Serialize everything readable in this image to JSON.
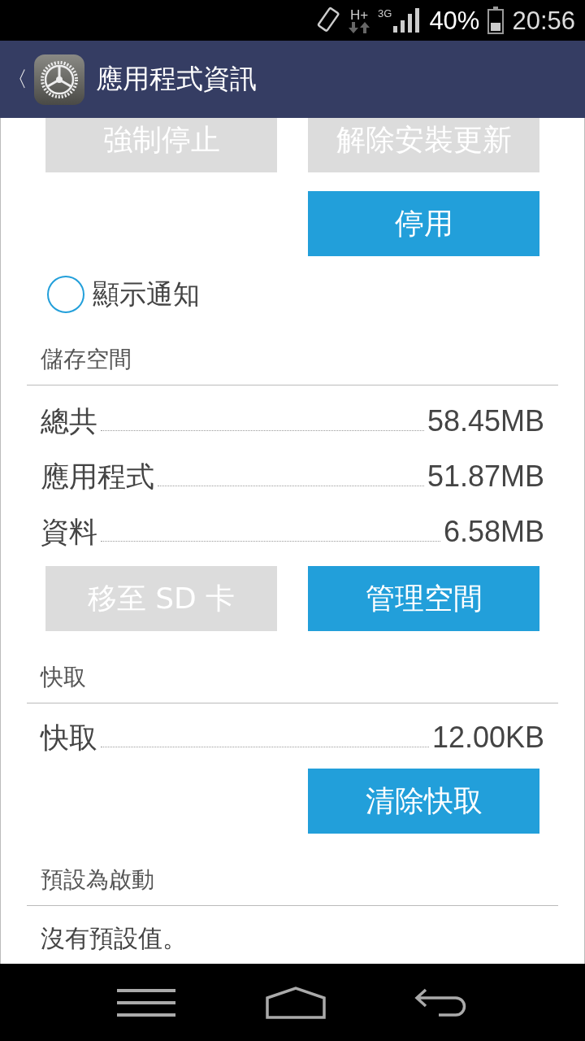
{
  "status_bar": {
    "data_type": "H+",
    "network": "3G",
    "battery": {
      "text": "40%"
    },
    "time": "20:56"
  },
  "app_bar": {
    "back": "〈",
    "title": "應用程式資訊"
  },
  "top_buttons": [
    {
      "label": "強制停止",
      "disabled": true
    },
    {
      "label": "解除安裝更新",
      "disabled": true
    }
  ],
  "disable_button": {
    "label": "停用",
    "disabled": false
  },
  "notification": {
    "label": "顯示通知",
    "checked": false
  },
  "storage": {
    "header": "儲存空間",
    "rows": [
      {
        "label": "總共",
        "value": "58.45MB"
      },
      {
        "label": "應用程式",
        "value": "51.87MB"
      },
      {
        "label": "資料",
        "value": "6.58MB"
      }
    ],
    "buttons": [
      {
        "label": "移至 SD 卡",
        "disabled": true
      },
      {
        "label": "管理空間",
        "disabled": false
      }
    ]
  },
  "cache": {
    "header": "快取",
    "rows": [
      {
        "label": "快取",
        "value": "12.00KB"
      }
    ],
    "button": {
      "label": "清除快取",
      "disabled": false
    }
  },
  "launch_default": {
    "header": "預設為啟動",
    "text": "沒有預設值。"
  }
}
